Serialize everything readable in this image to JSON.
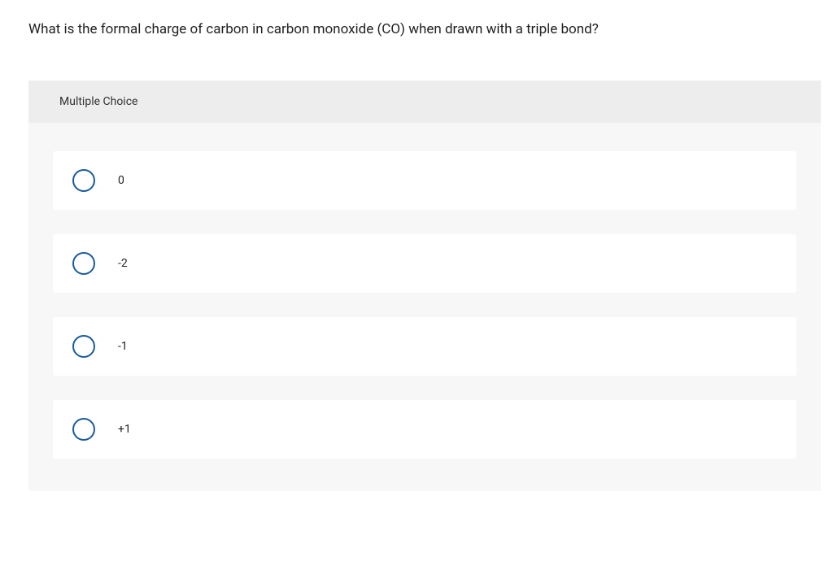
{
  "question": "What is the formal charge of carbon in carbon monoxide (CO) when drawn with a triple bond?",
  "header": "Multiple Choice",
  "options": [
    {
      "label": "0"
    },
    {
      "label": "-2"
    },
    {
      "label": "-1"
    },
    {
      "label": "+1"
    }
  ],
  "colors": {
    "radio_border": "#1a5b9e",
    "panel_bg": "#f7f7f7",
    "header_bg": "#ededed"
  }
}
